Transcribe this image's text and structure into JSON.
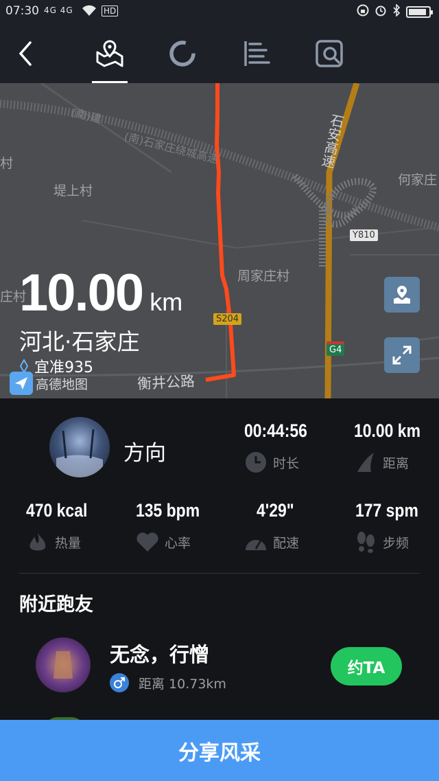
{
  "status_bar": {
    "time": "07:30",
    "signal_text": "4G 4G",
    "network_badge": "HD",
    "battery_level": 0.9
  },
  "toolbar": {
    "icons": [
      "back-icon",
      "map-route-icon",
      "ring-chart-icon",
      "list-chart-icon",
      "search-detail-icon"
    ],
    "active_tab": "map-route"
  },
  "map": {
    "total_distance": "10.00",
    "distance_unit": "km",
    "city": "河北·石家庄",
    "device": "宜准935",
    "provider": "高德地图",
    "places": {
      "cun_left": "村",
      "dishangcun": "堤上村",
      "hejiazhuang": "何家庄",
      "zhoujiazhuangcun": "周家庄村",
      "zhuangcun_left": "庄村",
      "shian_gaosu": "石安高速",
      "ring_road": "(南)石家庄绕城高速",
      "ring_road_left": "(南)建",
      "hengjing": "衡井公路"
    },
    "road_badges": {
      "y810": "Y810",
      "s204": "S204",
      "g4": "G4"
    },
    "colors": {
      "route": "#ff4a1c",
      "highway": "#c98a14",
      "background": "#4b4d50"
    }
  },
  "profile": {
    "name": "方向"
  },
  "stats": {
    "duration": {
      "value": "00:44:56",
      "label": "时长",
      "icon": "clock-icon"
    },
    "distance": {
      "value": "10.00 km",
      "label": "距离",
      "icon": "distance-icon"
    },
    "calories": {
      "value": "470 kcal",
      "label": "热量",
      "icon": "flame-icon"
    },
    "heart_rate": {
      "value": "135 bpm",
      "label": "心率",
      "icon": "heart-icon"
    },
    "pace": {
      "value": "4'29\"",
      "label": "配速",
      "icon": "gauge-icon"
    },
    "cadence": {
      "value": "177 spm",
      "label": "步频",
      "icon": "footprint-icon"
    }
  },
  "nearby": {
    "title": "附近跑友",
    "runners": [
      {
        "name": "无念，行憎",
        "gender": "male",
        "distance": "距离 10.73km",
        "action": "约TA"
      }
    ]
  },
  "share_button": "分享风采"
}
